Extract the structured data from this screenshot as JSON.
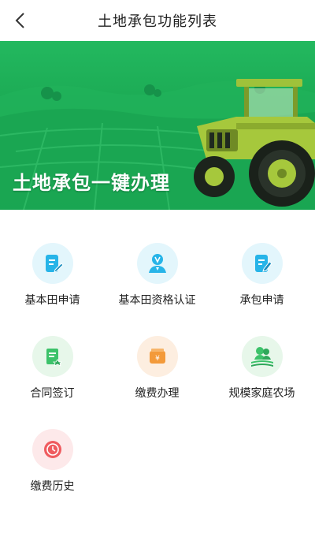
{
  "header": {
    "title": "土地承包功能列表",
    "back_icon": "back-chevron-icon"
  },
  "banner": {
    "title": "土地承包一键办理",
    "image": "tractor-field-illustration"
  },
  "colors": {
    "brand_green": "#1aa852",
    "blue_bg": "#e3f6fc",
    "blue_icon": "#27b4e8",
    "green_bg": "#e7f7ea",
    "green_icon": "#3cc26a",
    "orange_bg": "#fdeee0",
    "orange_icon": "#f39a3a",
    "red_bg": "#fde9ea",
    "red_icon": "#ef5b5f"
  },
  "functions": [
    {
      "label": "基本田申请",
      "icon": "document-edit-icon"
    },
    {
      "label": "基本田资格认证",
      "icon": "verified-user-icon"
    },
    {
      "label": "承包申请",
      "icon": "document-pen-icon"
    },
    {
      "label": "合同签订",
      "icon": "contract-sign-icon"
    },
    {
      "label": "缴费办理",
      "icon": "payment-wallet-icon"
    },
    {
      "label": "规模家庭农场",
      "icon": "family-farm-icon"
    },
    {
      "label": "缴费历史",
      "icon": "payment-history-icon"
    }
  ]
}
